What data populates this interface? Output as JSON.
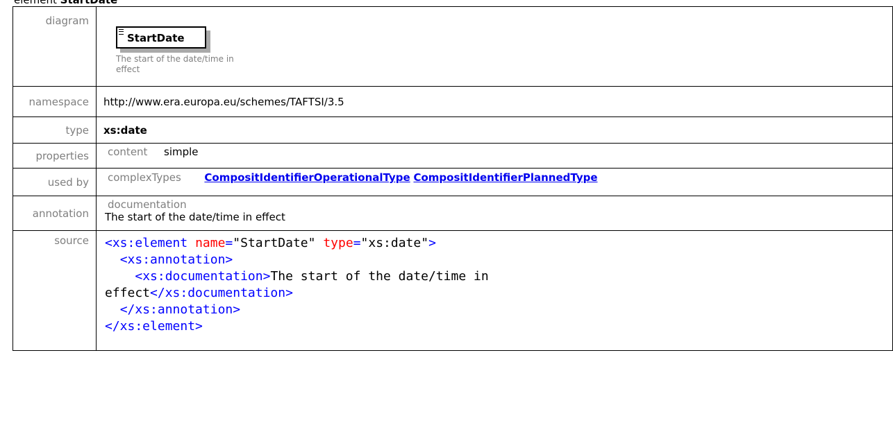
{
  "heading": {
    "prefix": "element",
    "name": "StartDate"
  },
  "rows": {
    "diagram": {
      "label": "diagram",
      "box_name": "StartDate",
      "note": "The start of the date/time in effect"
    },
    "namespace": {
      "label": "namespace",
      "value": "http://www.era.europa.eu/schemes/TAFTSI/3.5"
    },
    "type": {
      "label": "type",
      "value": "xs:date"
    },
    "properties": {
      "label": "properties",
      "key": "content",
      "value": "simple"
    },
    "used_by": {
      "label": "used by",
      "key": "complexTypes",
      "links": [
        "CompositIdentifierOperationalType",
        "CompositIdentifierPlannedType"
      ]
    },
    "annotation": {
      "label": "annotation",
      "key": "documentation",
      "value": "The start of the date/time in effect"
    },
    "source": {
      "label": "source",
      "lines": [
        {
          "tag_open": "<xs:element",
          "attrs": [
            {
              "name": "name",
              "value": "\"StartDate\""
            },
            {
              "name": "type",
              "value": "\"xs:date\""
            }
          ],
          "tag_close": ">"
        },
        {
          "indent": "  ",
          "tag": "<xs:annotation>"
        },
        {
          "indent": "    ",
          "tag": "<xs:documentation>",
          "text": "The start of the date/time in"
        },
        {
          "text": "effect",
          "tag": "</xs:documentation>"
        },
        {
          "indent": "  ",
          "tag": "</xs:annotation>"
        },
        {
          "tag": "</xs:element>"
        }
      ]
    }
  }
}
